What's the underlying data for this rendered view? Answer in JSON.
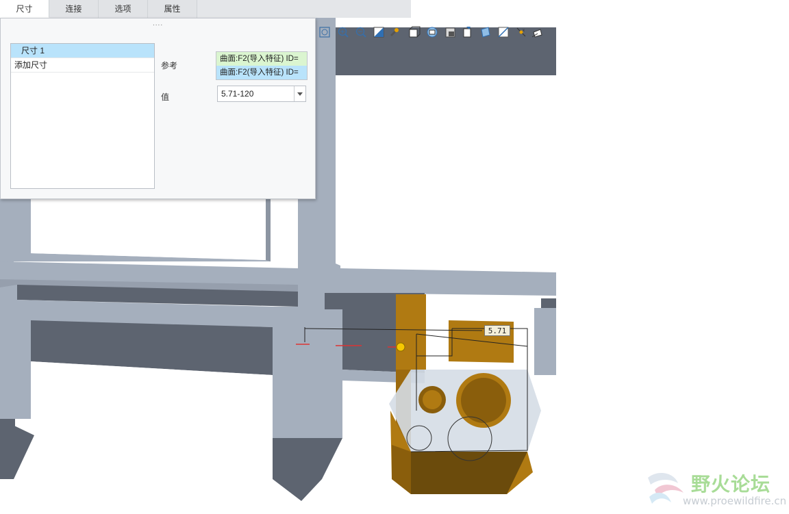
{
  "tabs": [
    {
      "label": "尺寸",
      "active": true
    },
    {
      "label": "连接",
      "active": false
    },
    {
      "label": "选项",
      "active": false
    },
    {
      "label": "属性",
      "active": false
    }
  ],
  "panel": {
    "grip": "....",
    "list_items": [
      "尺寸 1",
      "添加尺寸"
    ],
    "reference_label": "参考",
    "references": [
      "曲面:F2(导入特征) ID=",
      "曲面:F2(导入特征) ID="
    ],
    "value_label": "值",
    "value": "5.71-120"
  },
  "toolbar_icons": [
    "zoom-refit-icon",
    "zoom-in-icon",
    "zoom-out-icon",
    "repaint-icon",
    "spin-center-icon",
    "display-style-icon",
    "saved-views-icon",
    "view-manager-icon",
    "annotation-display-icon",
    "section-icon",
    "datum-plane-display-icon",
    "datum-axis-display-icon",
    "point-display-icon"
  ],
  "model": {
    "dimension_value": "5.71"
  },
  "watermark": {
    "text": "野火论坛",
    "url": "www.proewildfire.cn"
  },
  "colors": {
    "panel_bg": "#f7f8f9",
    "selected": "#b9e3fb",
    "ref_highlight": "#dbf5d0",
    "part_gray": "#a5afbd",
    "part_dark": "#5c6470",
    "component_orange": "#b07a12"
  }
}
